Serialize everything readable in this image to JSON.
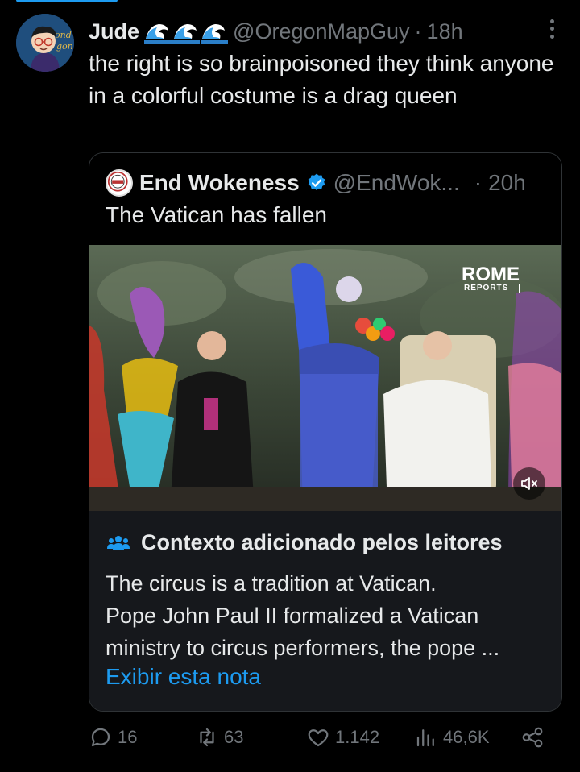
{
  "tweet": {
    "author_name": "Jude",
    "author_handle": "@OregonMapGuy",
    "separator": "·",
    "time": "18h",
    "text": "the right is so brainpoisoned they think anyone in a colorful costume is a drag queen",
    "avatar_icon": "avatar-cartoon-glasses",
    "name_emoji": "wave-emoji"
  },
  "quote": {
    "author_name": "End Wokeness",
    "author_handle": "@EndWok...",
    "separator": "·",
    "time": "20h",
    "text": "The Vatican has fallen",
    "verified_color": "#1d9bf0",
    "media": {
      "watermark_main": "ROME",
      "watermark_sub": "REPORTS",
      "mute_icon": "speaker-muted-icon"
    },
    "context": {
      "icon": "people-icon",
      "title": "Contexto adicionado pelos leitores",
      "lines": [
        "The circus is a tradition at Vatican.",
        "Pope John Paul II formalized a Vatican",
        "ministry to circus performers, the pope ..."
      ],
      "link": "Exibir esta nota"
    }
  },
  "actions": {
    "replies": "16",
    "reposts": "63",
    "likes": "1.142",
    "views": "46,6K"
  },
  "colors": {
    "background": "#000000",
    "text": "#e7e9ea",
    "muted": "#71767b",
    "accent": "#1d9bf0",
    "border": "#2f3336"
  }
}
